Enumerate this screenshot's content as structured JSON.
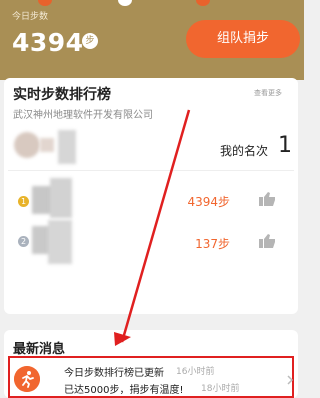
{
  "header": {
    "steps_label": "今日步数",
    "steps_value": "4394",
    "steps_unit": "步",
    "team_button": "组队捐步"
  },
  "leaderboard": {
    "title": "实时步数排行榜",
    "view_more": "查看更多",
    "company": "武汉神州地理软件开发有限公司",
    "my_rank_label": "我的名次",
    "my_rank_value": "1",
    "rows": [
      {
        "medal": "1",
        "steps": "4394步",
        "medal_color": "#e8b32a"
      },
      {
        "medal": "2",
        "steps": "137步",
        "medal_color": "#aab2bd"
      }
    ]
  },
  "news": {
    "title": "最新消息",
    "items": [
      {
        "text": "今日步数排行榜已更新",
        "time": "16小时前"
      },
      {
        "text": "已达5000步，捐步有温度!",
        "time": "18小时前"
      }
    ]
  },
  "colors": {
    "accent": "#f1662f",
    "header_bg": "#a98f55",
    "highlight": "#e02020"
  },
  "icons": [
    "chevron-right-icon",
    "thumbs-up-icon",
    "runner-icon",
    "medal-icon"
  ]
}
